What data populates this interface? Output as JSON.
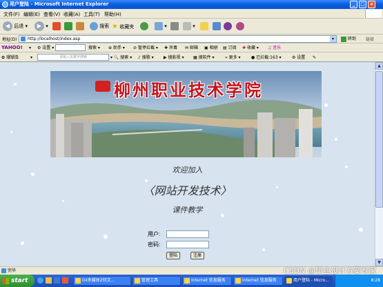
{
  "window": {
    "title": "用户登陆 - Microsoft Internet Explorer"
  },
  "menu": [
    "文件(F)",
    "编辑(E)",
    "查看(V)",
    "收藏(A)",
    "工具(T)",
    "帮助(H)"
  ],
  "toolbar": {
    "back": "后退",
    "search": "搜索",
    "favorites": "收藏夹"
  },
  "address": {
    "label": "地址(D)",
    "url": "http://localhost/index.asp",
    "go": "转到",
    "links": "链接"
  },
  "yahoo_bar": {
    "logo": "YAHOO!",
    "settings": "设置",
    "search": "搜索",
    "assistant": "助手",
    "popup_block": "暂停拦截",
    "antivirus": "杀毒",
    "mail": "邮箱",
    "photos": "相册",
    "subscribe": "订阅",
    "bookmarks": "收藏",
    "music": "音乐"
  },
  "bar4": {
    "brand": "珊瑚虫",
    "search_placeholder": "请输入关键字搜索",
    "search": "搜索",
    "music_search": "搜歌",
    "video_search": "搜影视",
    "software_search": "搜软件",
    "more": "更多",
    "blocked": "已拦截:163",
    "settings": "设置"
  },
  "banner": {
    "college_name": "柳州职业技术学院"
  },
  "page": {
    "welcome": "欢迎加入",
    "course": "〈网站开发技术〉",
    "subtitle": "课件教学",
    "username_label": "用户:",
    "password_label": "密码:",
    "login_button": "登陆",
    "register_button": "注册"
  },
  "status": {
    "text": "完毕"
  },
  "taskbar": {
    "start": "start",
    "tasks": [
      "04多媒体2何文...",
      "管理工具",
      "Internet 信息服务",
      "Internet 信息服务",
      "用户登陆 - Micro..."
    ],
    "clock": "8:28"
  },
  "overlay": {
    "watermark": "CSDN @毕业设计方案专家"
  },
  "colors": {
    "titlebar": "#0a5fe0",
    "content_bg": "#d7e3ef",
    "taskbar": "#2457c4",
    "start": "#2f8f2f"
  }
}
